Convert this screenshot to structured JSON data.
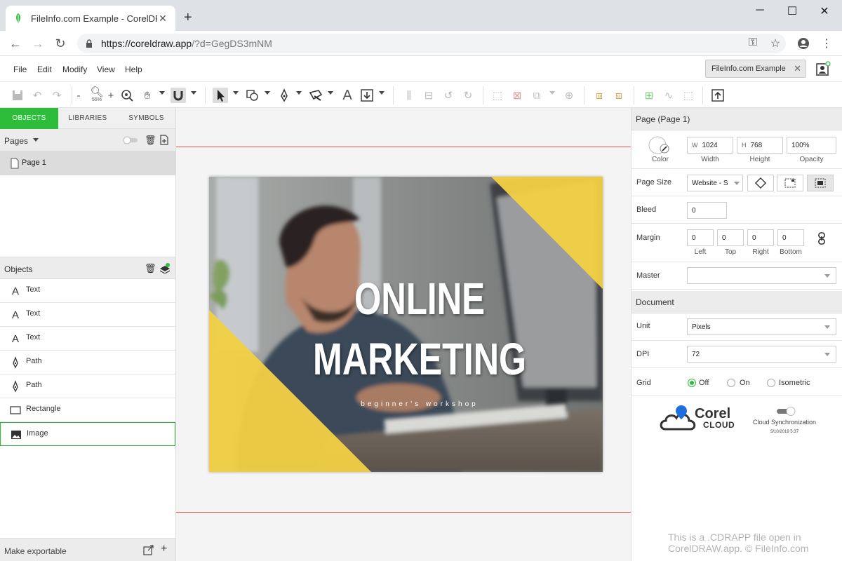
{
  "browser": {
    "tab_title": "FileInfo.com Example - CorelDRAW",
    "url_host": "https://coreldraw.app",
    "url_path": "/?d=GegDS3mNM"
  },
  "menu": {
    "file": "File",
    "edit": "Edit",
    "modify": "Modify",
    "view": "View",
    "help": "Help"
  },
  "file_chip": "FileInfo.com Example",
  "toolbar": {
    "zoom_level": "55%",
    "zoom_minus": "-",
    "zoom_plus": "+"
  },
  "left_tabs": {
    "objects": "OBJECTS",
    "libraries": "LIBRARIES",
    "symbols": "SYMBOLS"
  },
  "pages": {
    "header": "Pages",
    "items": [
      {
        "label": "Page 1"
      }
    ]
  },
  "objects": {
    "header": "Objects",
    "items": [
      {
        "label": "Text",
        "icon": "text-icon"
      },
      {
        "label": "Text",
        "icon": "text-icon"
      },
      {
        "label": "Text",
        "icon": "text-icon"
      },
      {
        "label": "Path",
        "icon": "pen-icon"
      },
      {
        "label": "Path",
        "icon": "pen-icon"
      },
      {
        "label": "Rectangle",
        "icon": "rectangle-icon"
      },
      {
        "label": "Image",
        "icon": "image-icon"
      }
    ],
    "selected_index": 6
  },
  "export_label": "Make exportable",
  "artboard": {
    "headline_1": "ONLINE",
    "headline_2": "MARKETING",
    "subtitle": "beginner's workshop",
    "accent_color": "#f2d043"
  },
  "page_props": {
    "header": "Page (Page 1)",
    "color_label": "Color",
    "width_prefix": "W",
    "width_value": "1024",
    "width_label": "Width",
    "height_prefix": "H",
    "height_value": "768",
    "height_label": "Height",
    "opacity_value": "100%",
    "opacity_label": "Opacity",
    "page_size_label": "Page Size",
    "page_size_value": "Website - S",
    "bleed_label": "Bleed",
    "bleed_value": "0",
    "margin_label": "Margin",
    "margins": [
      {
        "value": "0",
        "label": "Left"
      },
      {
        "value": "0",
        "label": "Top"
      },
      {
        "value": "0",
        "label": "Right"
      },
      {
        "value": "0",
        "label": "Bottom"
      }
    ],
    "master_label": "Master",
    "master_value": ""
  },
  "document": {
    "header": "Document",
    "unit_label": "Unit",
    "unit_value": "Pixels",
    "dpi_label": "DPI",
    "dpi_value": "72",
    "grid_label": "Grid",
    "grid_options": [
      "Off",
      "On",
      "Isometric"
    ],
    "grid_selected": "Off"
  },
  "corel_cloud": {
    "brand_1": "Corel",
    "brand_2": "CLOUD",
    "sync_label": "Cloud Synchronization",
    "sync_time": "5/10/2019 5:37"
  },
  "watermark": {
    "line1": "This is a .CDRAPP file open in",
    "line2": "CorelDRAW.app. © FileInfo.com"
  },
  "colors": {
    "accent_green": "#2dbd3b",
    "guide_red": "#e05050"
  }
}
